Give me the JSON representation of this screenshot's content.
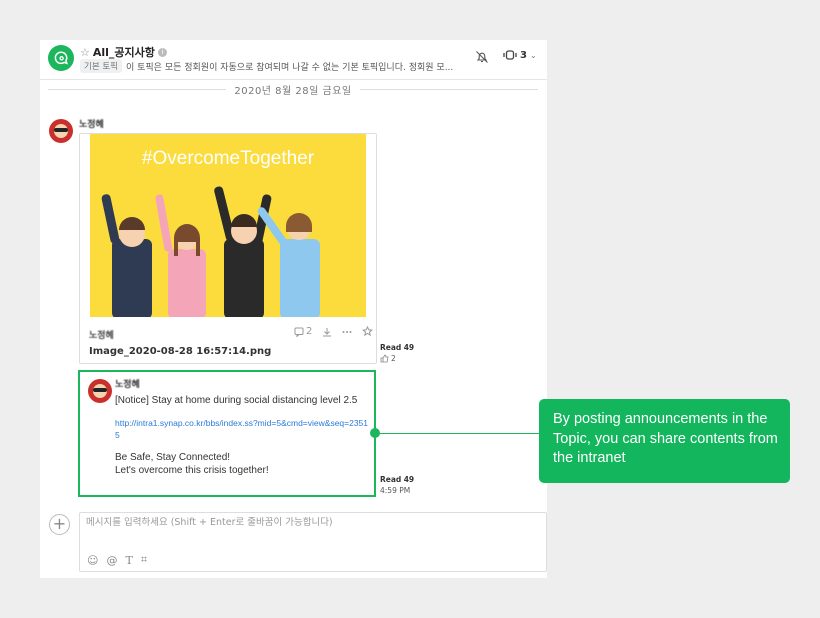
{
  "header": {
    "star": "☆",
    "topic_name": "All_공지사항",
    "info": "i",
    "badge": "기본 토픽",
    "description": "이 토픽은 모든 정회원이 자동으로 참여되며 나갈 수 없는 기본 토픽입니다. 정회원 모...",
    "member_count": "3",
    "chevron": "⌄"
  },
  "date_divider": "2020년 8월 28일 금요일",
  "message1": {
    "sender": "노정혜",
    "image": {
      "poster_title": "#OvercomeTogether",
      "sender": "노정혜",
      "comment_count": "2",
      "filename": "Image_2020-08-28 16:57:14.png"
    },
    "read": {
      "label": "Read",
      "count": "49"
    },
    "likes": "2"
  },
  "message2": {
    "sender": "노정혜",
    "line1": "[Notice] Stay at home during social distancing level 2.5",
    "link": "http://intra1.synap.co.kr/bbs/index.ss?mid=5&cmd=view&seq=23515",
    "line2": "Be Safe, Stay Connected!",
    "line3": "Let's overcome this crisis together!",
    "read": {
      "label": "Read",
      "count": "49"
    },
    "time": "4:59 PM"
  },
  "composer": {
    "add": "+",
    "placeholder": "메시지를 입력하세요 (Shift + Enter로 줄바꿈이 가능합니다)",
    "tools": {
      "emoji": "☺",
      "mention": "@",
      "text": "T",
      "hashtag": "⌗"
    }
  },
  "callout": {
    "text": "By posting announcements in the Topic, you can share contents from the intranet"
  },
  "colors": {
    "brand": "#1cb65c",
    "callout": "#13b55d",
    "link": "#2a7ad8",
    "poster": "#fbdc3c"
  }
}
